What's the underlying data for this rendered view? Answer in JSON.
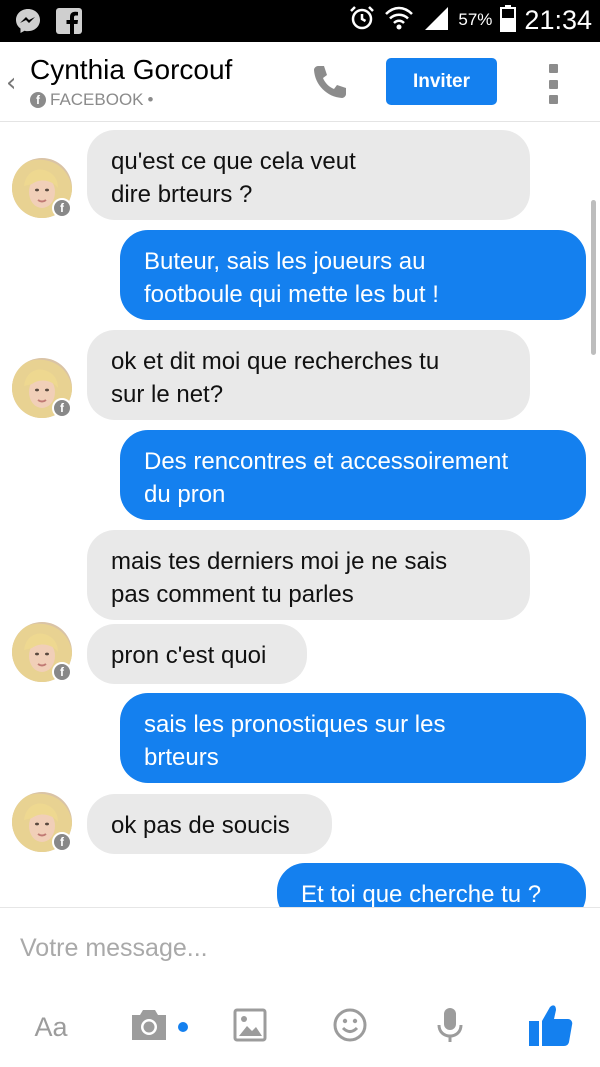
{
  "status_bar": {
    "battery_percent": "57%",
    "time": "21:34"
  },
  "header": {
    "contact_name": "Cynthia Gorcouf",
    "source_label": "FACEBOOK",
    "separator": "•",
    "invite_label": "Inviter"
  },
  "messages": [
    {
      "direction": "incoming",
      "text": "qu'est ce que cela veut\ndire brteurs ?"
    },
    {
      "direction": "outgoing",
      "text": "Buteur,  sais les joueurs au\nfootboule qui mette les but !"
    },
    {
      "direction": "incoming",
      "text": "ok et dit moi que recherches tu\nsur le net?"
    },
    {
      "direction": "outgoing",
      "text": "Des rencontres et accessoirement\ndu pron"
    },
    {
      "direction": "incoming",
      "text": "mais tes derniers moi je ne sais\npas  comment tu parles"
    },
    {
      "direction": "incoming",
      "text": "pron c'est quoi"
    },
    {
      "direction": "outgoing",
      "text": "sais les pronostiques sur les\nbrteurs"
    },
    {
      "direction": "incoming",
      "text": "ok pas de soucis"
    },
    {
      "direction": "outgoing",
      "text": "Et toi que cherche tu ?"
    }
  ],
  "composer": {
    "placeholder": "Votre message...",
    "text_tool_label": "Aa"
  },
  "icons": {
    "status_left": [
      "messenger-icon",
      "facebook-icon"
    ],
    "status_right": [
      "alarm-icon",
      "wifi-icon",
      "signal-icon",
      "battery-icon"
    ],
    "header": [
      "back-chevron-icon",
      "phone-icon",
      "more-options-icon"
    ],
    "toolbar": [
      "camera-icon",
      "gallery-icon",
      "emoji-icon",
      "microphone-icon",
      "thumbs-up-icon"
    ]
  },
  "colors": {
    "accent": "#1480ef",
    "incoming_bubble": "#e9e9e9",
    "status_bar": "#000000"
  }
}
